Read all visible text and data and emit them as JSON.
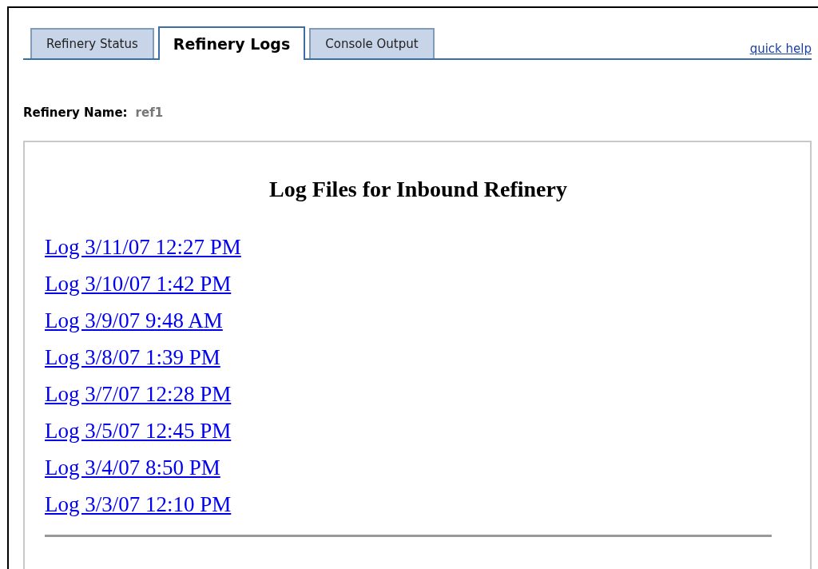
{
  "tabs": [
    {
      "label": "Refinery Status",
      "selected": false
    },
    {
      "label": "Refinery Logs",
      "selected": true
    },
    {
      "label": "Console Output",
      "selected": false
    }
  ],
  "quick_help": "quick help",
  "refinery": {
    "label": "Refinery Name:",
    "value": "ref1"
  },
  "log_panel": {
    "title": "Log Files for Inbound Refinery",
    "logs": [
      "Log 3/11/07 12:27 PM",
      "Log 3/10/07 1:42 PM",
      "Log 3/9/07 9:48 AM",
      "Log 3/8/07 1:39 PM",
      "Log 3/7/07 12:28 PM",
      "Log 3/5/07 12:45 PM",
      "Log 3/4/07 8:50 PM",
      "Log 3/3/07 12:10 PM"
    ]
  }
}
